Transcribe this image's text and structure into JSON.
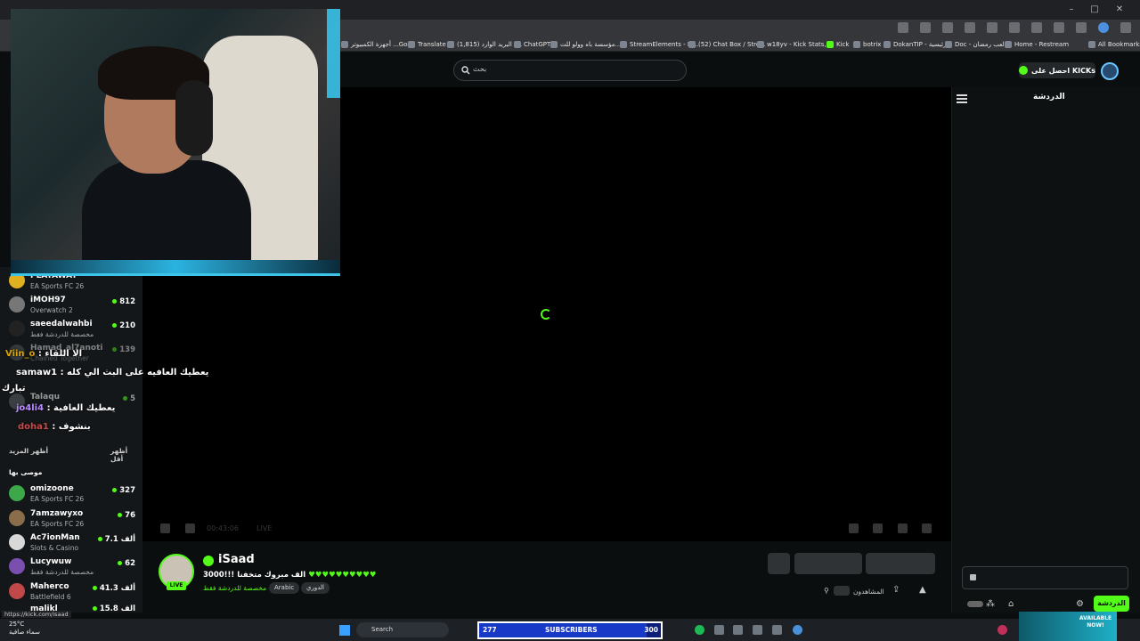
{
  "bookmarks": [
    "أجهزة الكمبيوتر ...Goo",
    "Translate",
    "البريد الوارد (1,815) -...",
    "ChatGPT",
    "مؤسسة باه وولو للت...",
    "StreamElements - M...",
    "(52) Chat Box / Stre...",
    "w18yv - Kick Stats,...",
    "Kick",
    "botrix",
    "DokanTIP - الرئيسية",
    "Doc - لعب رمضان",
    "Home - Restream",
    "All Bookmarks"
  ],
  "header": {
    "search_placeholder": "بحث",
    "get_kicks_label": "احصل على KICKs"
  },
  "player": {
    "time": "00:43:06",
    "live_label": "LIVE"
  },
  "chat": {
    "title": "الدردشة",
    "send_label": "الدردشة"
  },
  "sidebar": {
    "partial_top": {
      "name": "PLAYAWAY",
      "game": "EA Sports FC 26"
    },
    "following": [
      {
        "name": "iMOH97",
        "game": "Overwatch 2",
        "viewers": "812"
      },
      {
        "name": "saeedalwahbi",
        "game": "مخصصة للدردشة فقط",
        "viewers": "210"
      },
      {
        "name": "Hamad_al7anoti",
        "game": "Chained Together",
        "viewers": "139"
      },
      {
        "name": "Talaqu",
        "game": "",
        "viewers": "5"
      }
    ],
    "show_less": "أظهر أقل",
    "show_more": "أظهر المزيد",
    "recommended_title": "موصى بها",
    "recommended": [
      {
        "name": "omizoone",
        "game": "EA Sports FC 26",
        "viewers": "327"
      },
      {
        "name": "7amzawyxo",
        "game": "EA Sports FC 26",
        "viewers": "76"
      },
      {
        "name": "Ac7ionMan",
        "game": "Slots & Casino",
        "viewers": "7.1 ألف"
      },
      {
        "name": "Lucywuw",
        "game": "مخصصة للدردشة فقط",
        "viewers": "62"
      },
      {
        "name": "Maherco",
        "game": "Battlefield 6",
        "viewers": "41.3 ألف"
      },
      {
        "name": "malikl",
        "game": "",
        "viewers": "15.8 ألف"
      }
    ]
  },
  "overlay_chat": [
    {
      "user": "Viin_o",
      "text": ": الا اللقاء"
    },
    {
      "user": "samaw1",
      "text": ": يعطيك العافيه على البث الي كله"
    },
    {
      "user": "",
      "text": "تبارك"
    },
    {
      "user": "jo4li4",
      "text": ": يعطيك العافية"
    },
    {
      "user": "doha1",
      "text": ": بنشوف"
    }
  ],
  "streamer": {
    "name": "iSaad",
    "title": "الف مبروك متخفنا !!!3000",
    "category": "مخصصة للدردشة فقط",
    "tags": [
      "Arabic",
      "الدوري"
    ],
    "viewers_label": "المشاهدون",
    "live_badge": "LIVE"
  },
  "taskbar": {
    "temp": "25°C",
    "weather": "سماء صافية",
    "search": "Search",
    "subs_count": "277",
    "subs_label": "SUBSCRIBERS",
    "subs_goal": "300",
    "promo": "AVAILABLE NOW!"
  },
  "status_url": "https://kick.com/isaad",
  "colors": {
    "accent": "#53fc18",
    "background": "#0b0e0f",
    "subs_bar": "#1838c8"
  },
  "subs_progress": 0.92
}
